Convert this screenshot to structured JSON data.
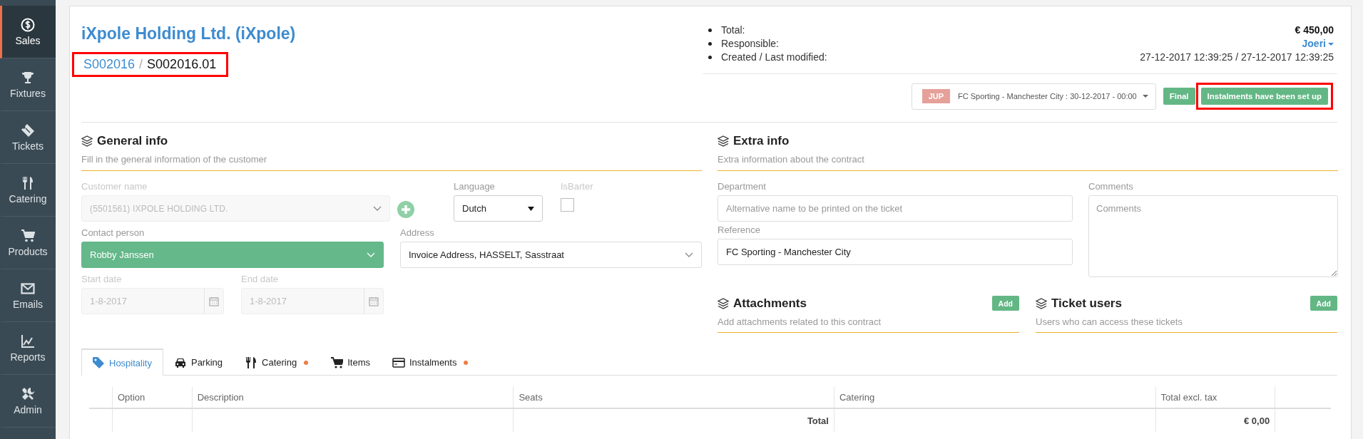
{
  "sidebar": {
    "items": [
      {
        "label": "Sales",
        "selected": true
      },
      {
        "label": "Fixtures",
        "selected": false
      },
      {
        "label": "Tickets",
        "selected": false
      },
      {
        "label": "Catering",
        "selected": false
      },
      {
        "label": "Products",
        "selected": false
      },
      {
        "label": "Emails",
        "selected": false
      },
      {
        "label": "Reports",
        "selected": false
      },
      {
        "label": "Admin",
        "selected": false
      }
    ]
  },
  "header": {
    "title": "iXpole Holding Ltd. (iXpole)",
    "breadcrumb": {
      "parent": "S002016",
      "separator": "/",
      "current": "S002016.01",
      "highlighted": true
    },
    "summary": [
      {
        "label": "Total:",
        "value": "€ 450,00",
        "kind": "bold"
      },
      {
        "label": "Responsible:",
        "value": "Joeri",
        "kind": "dropdown"
      },
      {
        "label": "Created / Last modified:",
        "value": "27-12-2017 12:39:25 / 27-12-2017 12:39:25",
        "kind": "plain"
      }
    ],
    "event_select": {
      "badge": "JUP",
      "value": "FC Sporting - Manchester City : 30-12-2017 - 00:00"
    },
    "buttons": [
      {
        "label": "Final",
        "highlighted": false
      },
      {
        "label": "Instalments have been set up",
        "highlighted": true
      }
    ]
  },
  "general_info": {
    "title": "General info",
    "subtitle": "Fill in the general information of the customer",
    "customer_name": {
      "label": "Customer name",
      "value": "(5501561) IXPOLE HOLDING LTD.",
      "disabled": true
    },
    "language": {
      "label": "Language",
      "value": "Dutch"
    },
    "is_barter": {
      "label": "IsBarter",
      "checked": false,
      "disabled": true
    },
    "contact_person": {
      "label": "Contact person",
      "value": "Robby Janssen"
    },
    "address": {
      "label": "Address",
      "value": "Invoice Address, HASSELT, Sasstraat"
    },
    "start_date": {
      "label": "Start date",
      "value": "1-8-2017",
      "disabled": true
    },
    "end_date": {
      "label": "End date",
      "value": "1-8-2017",
      "disabled": true
    }
  },
  "extra_info": {
    "title": "Extra info",
    "subtitle": "Extra information about the contract",
    "department": {
      "label": "Department",
      "placeholder": "Alternative name to be printed on the ticket"
    },
    "comments": {
      "label": "Comments",
      "placeholder": "Comments"
    },
    "reference": {
      "label": "Reference",
      "value": "FC Sporting - Manchester City"
    }
  },
  "attachments": {
    "title": "Attachments",
    "subtitle": "Add attachments related to this contract",
    "button": "Add"
  },
  "ticket_users": {
    "title": "Ticket users",
    "subtitle": "Users who can access these tickets",
    "button": "Add"
  },
  "tabs": [
    {
      "label": "Hospitality",
      "selected": true,
      "marker": false
    },
    {
      "label": "Parking",
      "selected": false,
      "marker": false
    },
    {
      "label": "Catering",
      "selected": false,
      "marker": true
    },
    {
      "label": "Items",
      "selected": false,
      "marker": false
    },
    {
      "label": "Instalments",
      "selected": false,
      "marker": true
    }
  ],
  "table": {
    "columns": [
      "Option",
      "Description",
      "Seats",
      "Catering",
      "Total excl. tax"
    ],
    "total_row": {
      "label": "Total",
      "value": "€ 0,00"
    }
  }
}
